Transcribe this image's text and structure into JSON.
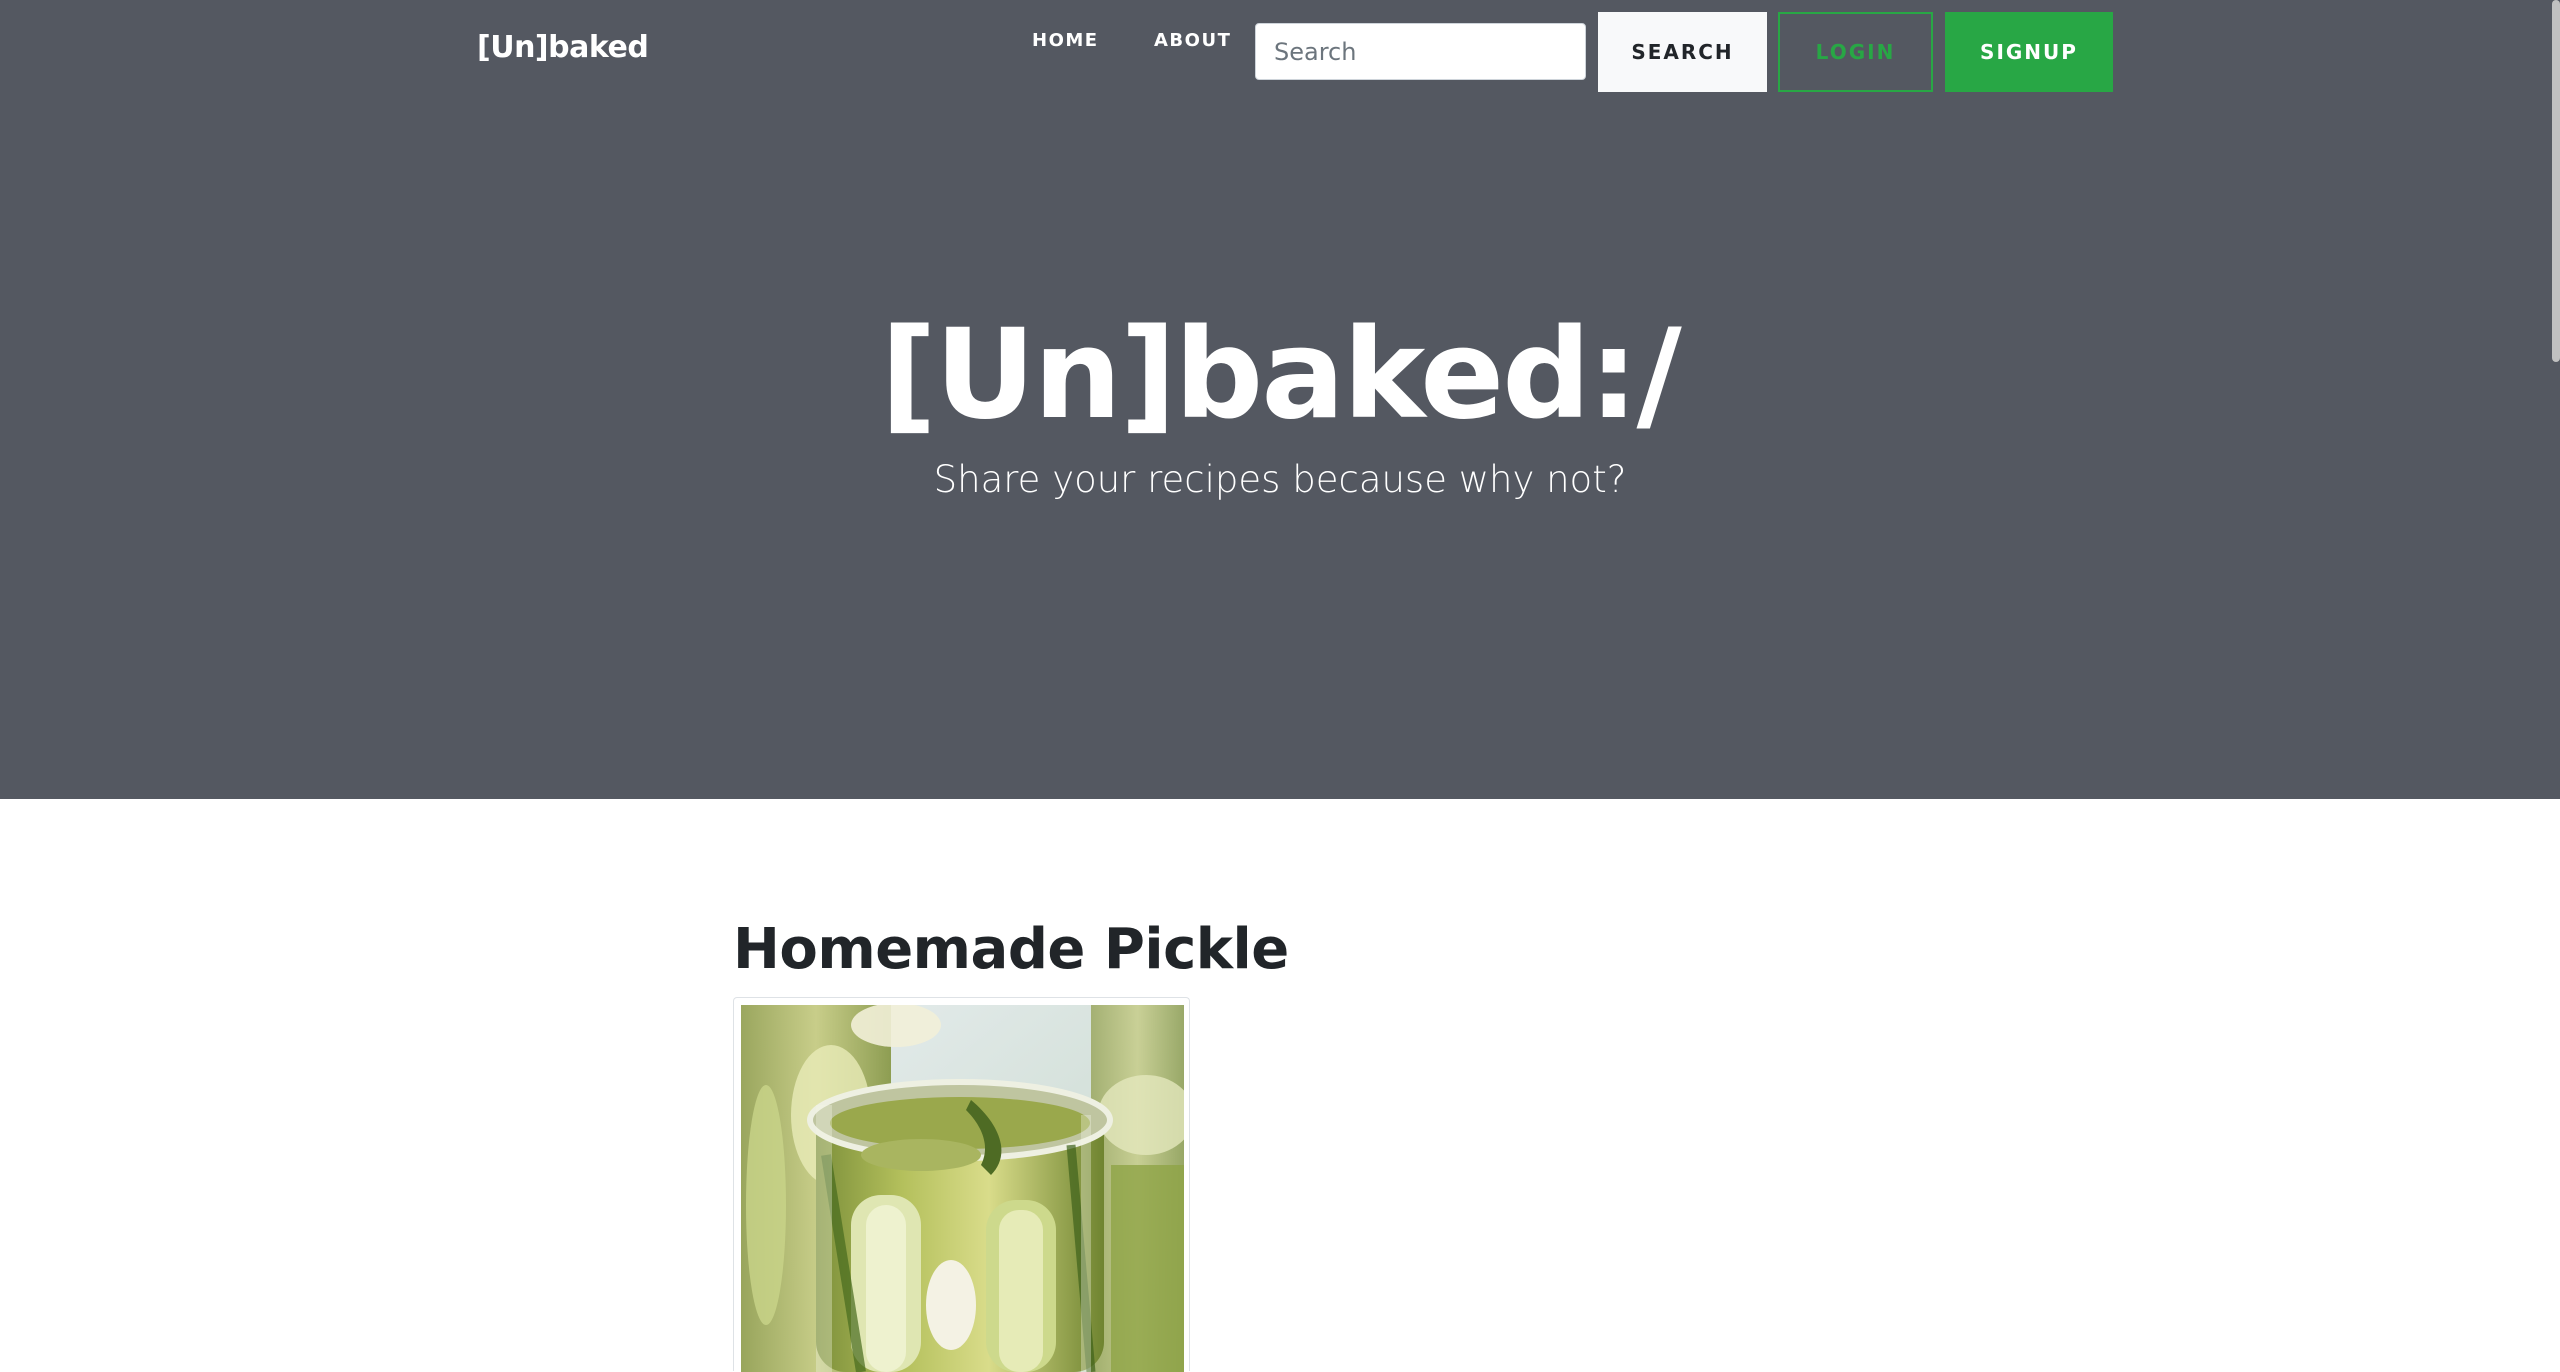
{
  "navbar": {
    "brand": "[Un]baked",
    "links": [
      {
        "label": "HOME"
      },
      {
        "label": "ABOUT"
      }
    ],
    "search": {
      "placeholder": "Search",
      "value": ""
    },
    "search_button": "SEARCH",
    "login_button": "LOGIN",
    "signup_button": "SIGNUP"
  },
  "hero": {
    "title": "[Un]baked:/",
    "subtitle": "Share your recipes because why not?"
  },
  "recipe": {
    "title": "Homemade Pickle"
  },
  "colors": {
    "masthead": "#545861",
    "accent_green": "#28a745",
    "search_button_bg": "#f8f9fa",
    "heading_text": "#212529"
  }
}
